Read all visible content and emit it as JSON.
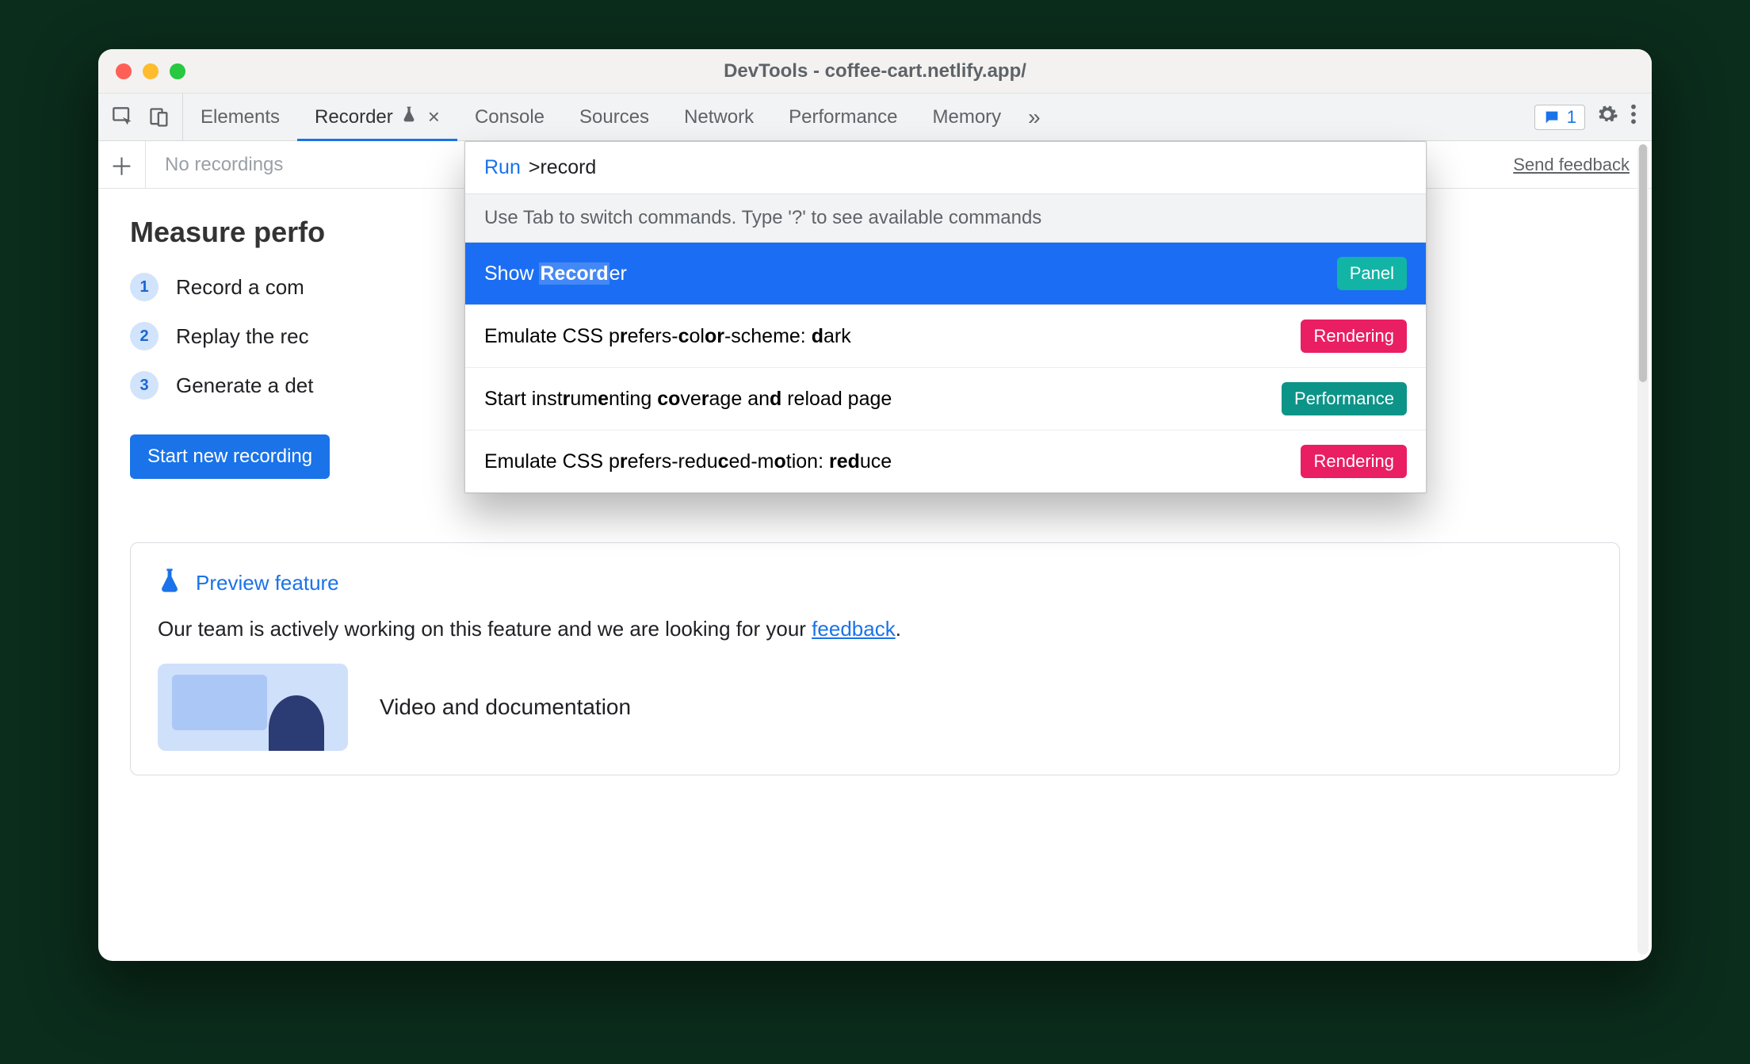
{
  "window": {
    "title": "DevTools - coffee-cart.netlify.app/"
  },
  "toolbar": {
    "tabs": [
      {
        "label": "Elements",
        "active": false
      },
      {
        "label": "Recorder",
        "active": true,
        "experimental": true,
        "closable": true
      },
      {
        "label": "Console",
        "active": false
      },
      {
        "label": "Sources",
        "active": false
      },
      {
        "label": "Network",
        "active": false
      },
      {
        "label": "Performance",
        "active": false
      },
      {
        "label": "Memory",
        "active": false
      }
    ],
    "overflow_glyph": "»",
    "issues_count": "1"
  },
  "subbar": {
    "no_recordings": "No recordings",
    "send_feedback": "Send feedback"
  },
  "page": {
    "heading": "Measure perfo",
    "steps": [
      {
        "n": "1",
        "text": "Record a com"
      },
      {
        "n": "2",
        "text": "Replay the rec"
      },
      {
        "n": "3",
        "text": "Generate a det"
      }
    ],
    "start_button": "Start new recording"
  },
  "preview": {
    "title": "Preview feature",
    "body_pre": "Our team is actively working on this feature and we are looking for your ",
    "body_link": "feedback",
    "body_post": ".",
    "media_title": "Video and documentation"
  },
  "palette": {
    "run_label": "Run",
    "query": ">record",
    "hint": "Use Tab to switch commands. Type '?' to see available commands",
    "items": [
      {
        "html": "Show <span class='hil'><b>Record</b></span>er",
        "tag": "Panel",
        "tag_class": "panel",
        "selected": true
      },
      {
        "html": "Emulate CSS p<b>r</b>efers-<b>c</b>ol<b>or</b>-scheme: <b>d</b>ark",
        "tag": "Rendering",
        "tag_class": "rendering",
        "selected": false
      },
      {
        "html": "Start inst<b>r</b>um<b>e</b>nting <b>co</b>ve<b>r</b>age an<b>d</b> reload page",
        "tag": "Performance",
        "tag_class": "perf",
        "selected": false
      },
      {
        "html": "Emulate CSS p<b>r</b>efers-redu<b>c</b>ed-m<b>o</b>tion: <b>red</b>uce",
        "tag": "Rendering",
        "tag_class": "rendering",
        "selected": false
      }
    ]
  }
}
